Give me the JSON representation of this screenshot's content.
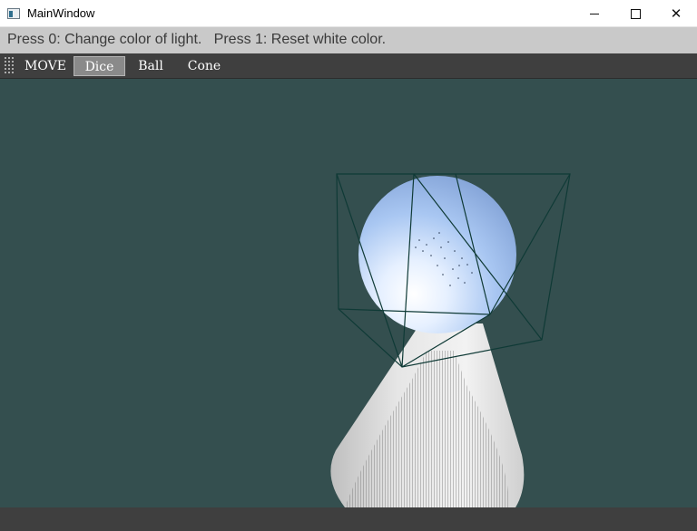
{
  "window": {
    "title": "MainWindow"
  },
  "hint": {
    "text": "Press 0: Change color of light.   Press 1: Reset white color."
  },
  "toolbar": {
    "items": [
      {
        "label": "MOVE",
        "active": false
      },
      {
        "label": "Dice",
        "active": true
      },
      {
        "label": "Ball",
        "active": false
      },
      {
        "label": "Cone",
        "active": false
      }
    ]
  },
  "scene": {
    "background": "#344f4f",
    "wire_color": "#0f3a36",
    "ball_color": "#a8c8f0",
    "cone_color": "#d8d8d8"
  }
}
